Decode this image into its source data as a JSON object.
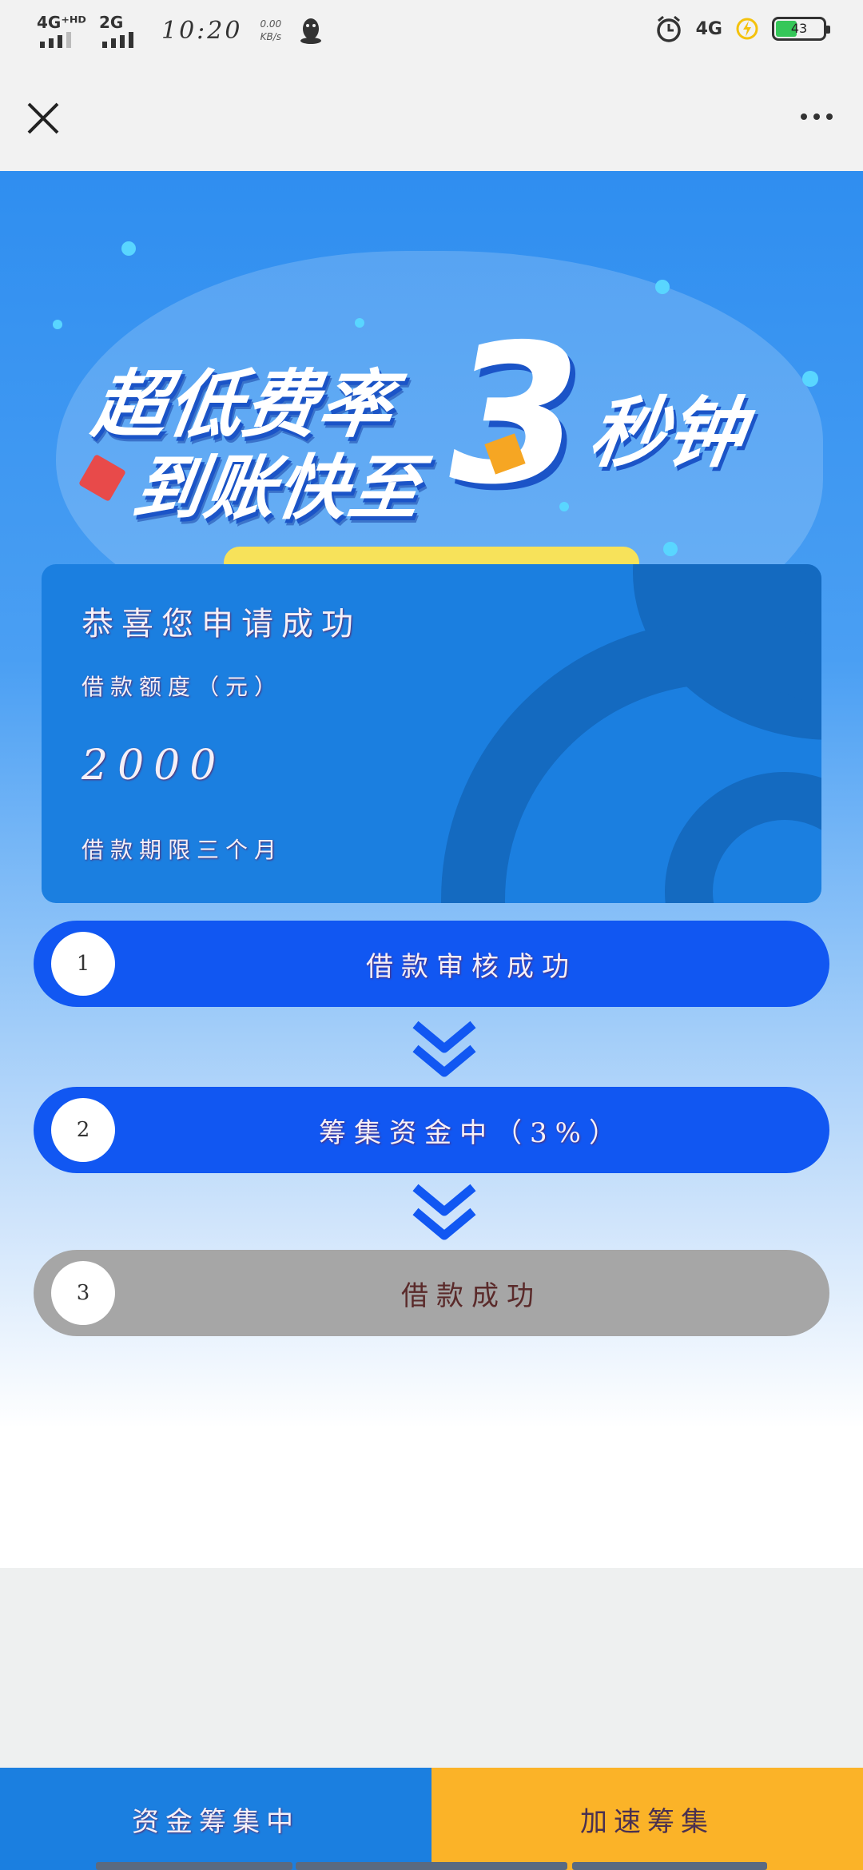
{
  "status_bar": {
    "network1": "4G⁺ᴴᴰ",
    "network2": "2G",
    "time": "10:20",
    "speed_value": "0.00",
    "speed_unit": "KB/s",
    "network3": "4G",
    "battery": "43"
  },
  "nav": {
    "close_icon": "close-icon",
    "more_icon": "more-icon"
  },
  "banner": {
    "line1": "超低费率",
    "line2": "到账快至",
    "big_number": "3",
    "suffix": "秒钟"
  },
  "card": {
    "title": "恭喜您申请成功",
    "amount_label": "借款额度（元）",
    "amount": "2000",
    "term": "借款期限三个月"
  },
  "steps": [
    {
      "number": "1",
      "label": "借款审核成功",
      "state": "active"
    },
    {
      "number": "2",
      "label": "筹集资金中（3%）",
      "state": "active"
    },
    {
      "number": "3",
      "label": "借款成功",
      "state": "inactive"
    }
  ],
  "bottom_bar": {
    "left_label": "资金筹集中",
    "right_label": "加速筹集"
  },
  "colors": {
    "step_active": "#1157f2",
    "step_inactive": "#a6a6a6",
    "card": "#1b7fe0",
    "accent_orange": "#fbb328"
  }
}
